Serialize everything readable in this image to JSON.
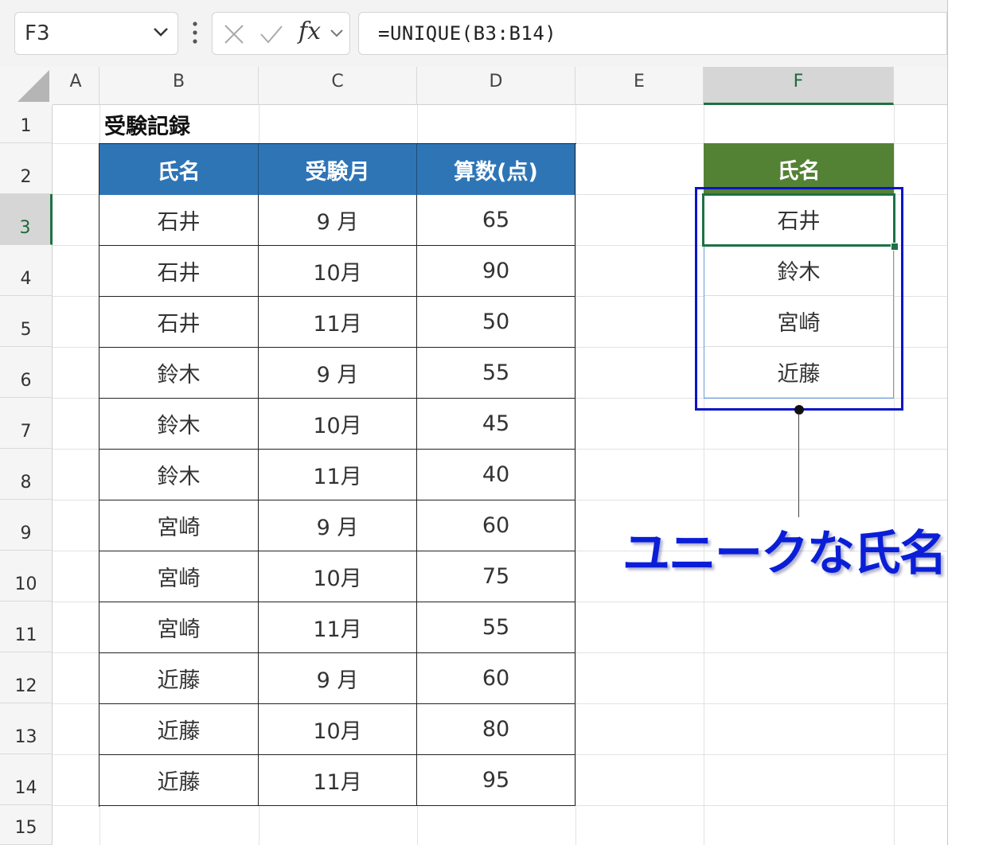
{
  "formula_bar": {
    "name_box": "F3",
    "fx_label": "fx",
    "formula": "=UNIQUE(B3:B14)"
  },
  "columns": [
    "A",
    "B",
    "C",
    "D",
    "E",
    "F"
  ],
  "rows": [
    "1",
    "2",
    "3",
    "4",
    "5",
    "6",
    "7",
    "8",
    "9",
    "10",
    "11",
    "12",
    "13",
    "14",
    "15"
  ],
  "selected_column": "F",
  "selected_row": "3",
  "sheet": {
    "title": "受験記録",
    "headers": [
      "氏名",
      "受験月",
      "算数(点)"
    ],
    "records": [
      [
        "石井",
        "9 月",
        "65"
      ],
      [
        "石井",
        "10月",
        "90"
      ],
      [
        "石井",
        "11月",
        "50"
      ],
      [
        "鈴木",
        "9 月",
        "55"
      ],
      [
        "鈴木",
        "10月",
        "45"
      ],
      [
        "鈴木",
        "11月",
        "40"
      ],
      [
        "宮崎",
        "9 月",
        "60"
      ],
      [
        "宮崎",
        "10月",
        "75"
      ],
      [
        "宮崎",
        "11月",
        "55"
      ],
      [
        "近藤",
        "9 月",
        "60"
      ],
      [
        "近藤",
        "10月",
        "80"
      ],
      [
        "近藤",
        "11月",
        "95"
      ]
    ]
  },
  "unique": {
    "header": "氏名",
    "values": [
      "石井",
      "鈴木",
      "宮崎",
      "近藤"
    ]
  },
  "annotation": {
    "text": "ユニークな氏名"
  },
  "colors": {
    "table_header": "#2e75b6",
    "unique_header": "#548235",
    "selection": "#1e7145",
    "annotation": "#0a1ed8"
  }
}
